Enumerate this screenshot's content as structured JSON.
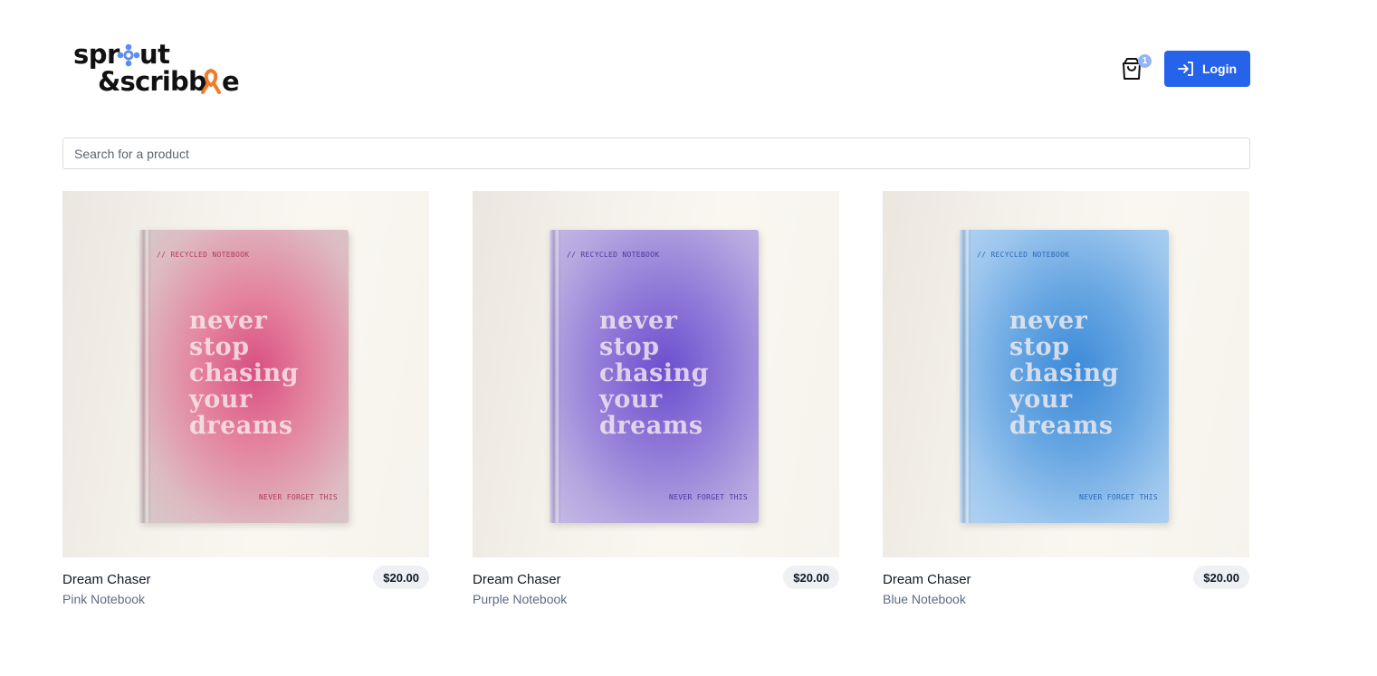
{
  "header": {
    "logo": {
      "line1": "sprout",
      "line2": "&scribble",
      "icons": [
        "flower-icon",
        "ribbon-icon"
      ]
    },
    "cart": {
      "icon": "shopping-bag-icon",
      "count": "1"
    },
    "login": {
      "icon": "login-arrow-icon",
      "label": "Login"
    }
  },
  "search": {
    "placeholder": "Search for a product",
    "value": ""
  },
  "products": [
    {
      "name": "Dream Chaser",
      "variant": "Pink Notebook",
      "price": "$20.00",
      "cover": {
        "top": "// RECYCLED NOTEBOOK",
        "quote": [
          "never",
          "stop",
          "chasing",
          "your",
          "dreams"
        ],
        "bottom": "NEVER FORGET THIS",
        "color": "#d84f82"
      }
    },
    {
      "name": "Dream Chaser",
      "variant": "Purple Notebook",
      "price": "$20.00",
      "cover": {
        "top": "// RECYCLED NOTEBOOK",
        "quote": [
          "never",
          "stop",
          "chasing",
          "your",
          "dreams"
        ],
        "bottom": "NEVER FORGET THIS",
        "color": "#6a4fcf"
      }
    },
    {
      "name": "Dream Chaser",
      "variant": "Blue Notebook",
      "price": "$20.00",
      "cover": {
        "top": "// RECYCLED NOTEBOOK",
        "quote": [
          "never",
          "stop",
          "chasing",
          "your",
          "dreams"
        ],
        "bottom": "NEVER FORGET THIS",
        "color": "#3b8ad8"
      }
    }
  ],
  "colors": {
    "primary": "#2563eb",
    "logo_accent_blue": "#5b8def",
    "logo_accent_orange": "#f07b2a"
  }
}
